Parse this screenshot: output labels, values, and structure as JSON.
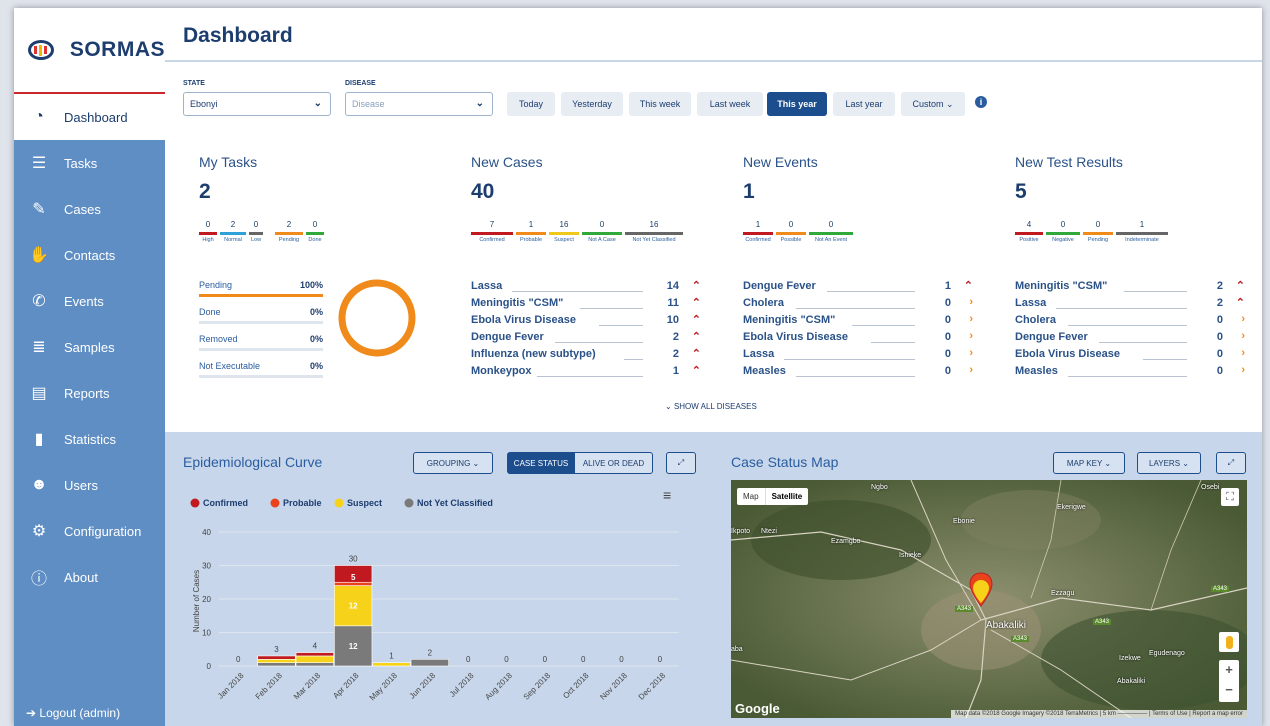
{
  "app": {
    "name": "SORMAS"
  },
  "sidebar": {
    "items": [
      {
        "label": "Dashboard",
        "icon": "dashboard-icon"
      },
      {
        "label": "Tasks",
        "icon": "tasks-icon"
      },
      {
        "label": "Cases",
        "icon": "cases-edit-icon"
      },
      {
        "label": "Contacts",
        "icon": "hand-icon"
      },
      {
        "label": "Events",
        "icon": "phone-icon"
      },
      {
        "label": "Samples",
        "icon": "database-icon"
      },
      {
        "label": "Reports",
        "icon": "file-icon"
      },
      {
        "label": "Statistics",
        "icon": "bar-chart-icon"
      },
      {
        "label": "Users",
        "icon": "users-icon"
      },
      {
        "label": "Configuration",
        "icon": "gears-icon"
      },
      {
        "label": "About",
        "icon": "info-icon"
      }
    ],
    "logout": "Logout (admin)"
  },
  "header": {
    "title": "Dashboard"
  },
  "filters": {
    "state_label": "STATE",
    "state_value": "Ebonyi",
    "disease_label": "DISEASE",
    "disease_placeholder": "Disease",
    "periods": [
      "Today",
      "Yesterday",
      "This week",
      "Last week",
      "This year",
      "Last year",
      "Custom ⌄"
    ],
    "active_period": "This year"
  },
  "stats": [
    {
      "title": "My Tasks",
      "total": "2",
      "subs": [
        {
          "n": "0",
          "l": "High",
          "c": "#c01a20"
        },
        {
          "n": "2",
          "l": "Normal",
          "c": "#2ea2d8"
        },
        {
          "n": "0",
          "l": "Low",
          "c": "#666"
        },
        {
          "n": "2",
          "l": "Pending",
          "c": "#f08a1a"
        },
        {
          "n": "0",
          "l": "Done",
          "c": "#31a83a"
        }
      ]
    },
    {
      "title": "New Cases",
      "total": "40",
      "subs": [
        {
          "n": "7",
          "l": "Confirmed",
          "c": "#c01a20"
        },
        {
          "n": "1",
          "l": "Probable",
          "c": "#f08a1a"
        },
        {
          "n": "16",
          "l": "Suspect",
          "c": "#f0c81a"
        },
        {
          "n": "0",
          "l": "Not A Case",
          "c": "#31a83a"
        },
        {
          "n": "16",
          "l": "Not Yet Classified",
          "c": "#666"
        }
      ]
    },
    {
      "title": "New Events",
      "total": "1",
      "subs": [
        {
          "n": "1",
          "l": "Confirmed",
          "c": "#c01a20"
        },
        {
          "n": "0",
          "l": "Possible",
          "c": "#f08a1a"
        },
        {
          "n": "0",
          "l": "Not An Event",
          "c": "#31a83a"
        }
      ]
    },
    {
      "title": "New Test Results",
      "total": "5",
      "subs": [
        {
          "n": "4",
          "l": "Positive",
          "c": "#c01a20"
        },
        {
          "n": "0",
          "l": "Negative",
          "c": "#31a83a"
        },
        {
          "n": "0",
          "l": "Pending",
          "c": "#f08a1a"
        },
        {
          "n": "1",
          "l": "Indeterminate",
          "c": "#666"
        }
      ]
    }
  ],
  "tasks_progress": [
    {
      "label": "Pending",
      "pct": "100%",
      "fill": 1.0
    },
    {
      "label": "Done",
      "pct": "0%",
      "fill": 0
    },
    {
      "label": "Removed",
      "pct": "0%",
      "fill": 0
    },
    {
      "label": "Not Executable",
      "pct": "0%",
      "fill": 0
    }
  ],
  "disease_lists": [
    [],
    [
      {
        "name": "Lassa",
        "n": "14",
        "t": "up"
      },
      {
        "name": "Meningitis \"CSM\"",
        "n": "11",
        "t": "up"
      },
      {
        "name": "Ebola Virus Disease",
        "n": "10",
        "t": "up"
      },
      {
        "name": "Dengue Fever",
        "n": "2",
        "t": "up"
      },
      {
        "name": "Influenza (new subtype)",
        "n": "2",
        "t": "up"
      },
      {
        "name": "Monkeypox",
        "n": "1",
        "t": "up"
      }
    ],
    [
      {
        "name": "Dengue Fever",
        "n": "1",
        "t": "up"
      },
      {
        "name": "Cholera",
        "n": "0",
        "t": "right"
      },
      {
        "name": "Meningitis \"CSM\"",
        "n": "0",
        "t": "right"
      },
      {
        "name": "Ebola Virus Disease",
        "n": "0",
        "t": "right"
      },
      {
        "name": "Lassa",
        "n": "0",
        "t": "right"
      },
      {
        "name": "Measles",
        "n": "0",
        "t": "right"
      }
    ],
    [
      {
        "name": "Meningitis \"CSM\"",
        "n": "2",
        "t": "up"
      },
      {
        "name": "Lassa",
        "n": "2",
        "t": "up"
      },
      {
        "name": "Cholera",
        "n": "0",
        "t": "right"
      },
      {
        "name": "Dengue Fever",
        "n": "0",
        "t": "right"
      },
      {
        "name": "Ebola Virus Disease",
        "n": "0",
        "t": "right"
      },
      {
        "name": "Measles",
        "n": "0",
        "t": "right"
      }
    ]
  ],
  "show_all": "SHOW ALL DISEASES",
  "epi": {
    "title": "Epidemiological Curve",
    "grouping": "GROUPING ⌄",
    "case_status": "CASE STATUS",
    "alive_or_dead": "ALIVE OR DEAD"
  },
  "map": {
    "title": "Case Status Map",
    "map_key": "MAP KEY ⌄",
    "layers": "LAYERS ⌄",
    "tab_map": "Map",
    "tab_satellite": "Satellite",
    "places": [
      "Ngbo",
      "Ekerigwe",
      "Ebonie",
      "Ezamgbo",
      "Ishieke",
      "Ntezi",
      "Ezzagu",
      "Abakaliki",
      "Izekwe",
      "Egudenago",
      "Abakaliki",
      "Osebi",
      "Ikpoto",
      "aba"
    ],
    "roads": [
      "A343",
      "A343",
      "A343",
      "A343"
    ],
    "brand": "Google",
    "attribution": "Map data ©2018 Google Imagery ©2018 TerraMetrics | 5 km ─────── | Terms of Use | Report a map error"
  },
  "chart_data": {
    "type": "bar",
    "categories": [
      "Jan 2018",
      "Feb 2018",
      "Mar 2018",
      "Apr 2018",
      "May 2018",
      "Jun 2018",
      "Jul 2018",
      "Aug 2018",
      "Sep 2018",
      "Oct 2018",
      "Nov 2018",
      "Dec 2018"
    ],
    "series": [
      {
        "name": "Confirmed",
        "color": "#c01a20",
        "values": [
          0,
          1,
          1,
          5,
          0,
          0,
          0,
          0,
          0,
          0,
          0,
          0
        ]
      },
      {
        "name": "Probable",
        "color": "#e8431a",
        "values": [
          0,
          0,
          0,
          1,
          0,
          0,
          0,
          0,
          0,
          0,
          0,
          0
        ]
      },
      {
        "name": "Suspect",
        "color": "#f7d21a",
        "values": [
          0,
          1,
          2,
          12,
          1,
          0,
          0,
          0,
          0,
          0,
          0,
          0
        ]
      },
      {
        "name": "Not Yet Classified",
        "color": "#7a7a7a",
        "values": [
          0,
          1,
          1,
          12,
          0,
          2,
          0,
          0,
          0,
          0,
          0,
          0
        ]
      }
    ],
    "totals": [
      0,
      3,
      4,
      30,
      1,
      2,
      0,
      0,
      0,
      0,
      0,
      0
    ],
    "bar_labels": [
      {
        "month": "Feb 2018",
        "values": [
          "1",
          "1",
          "1"
        ]
      },
      {
        "month": "Mar 2018",
        "values": [
          "1",
          "2",
          "1"
        ]
      },
      {
        "month": "Apr 2018",
        "values": [
          "5",
          "12",
          "12"
        ]
      },
      {
        "month": "May 2018",
        "values": [
          "1"
        ]
      },
      {
        "month": "Jun 2018",
        "values": [
          "2"
        ]
      }
    ],
    "ylabel": "Number of Cases",
    "yticks": [
      0,
      10,
      20,
      30,
      40
    ],
    "ylim": [
      0,
      40
    ]
  }
}
